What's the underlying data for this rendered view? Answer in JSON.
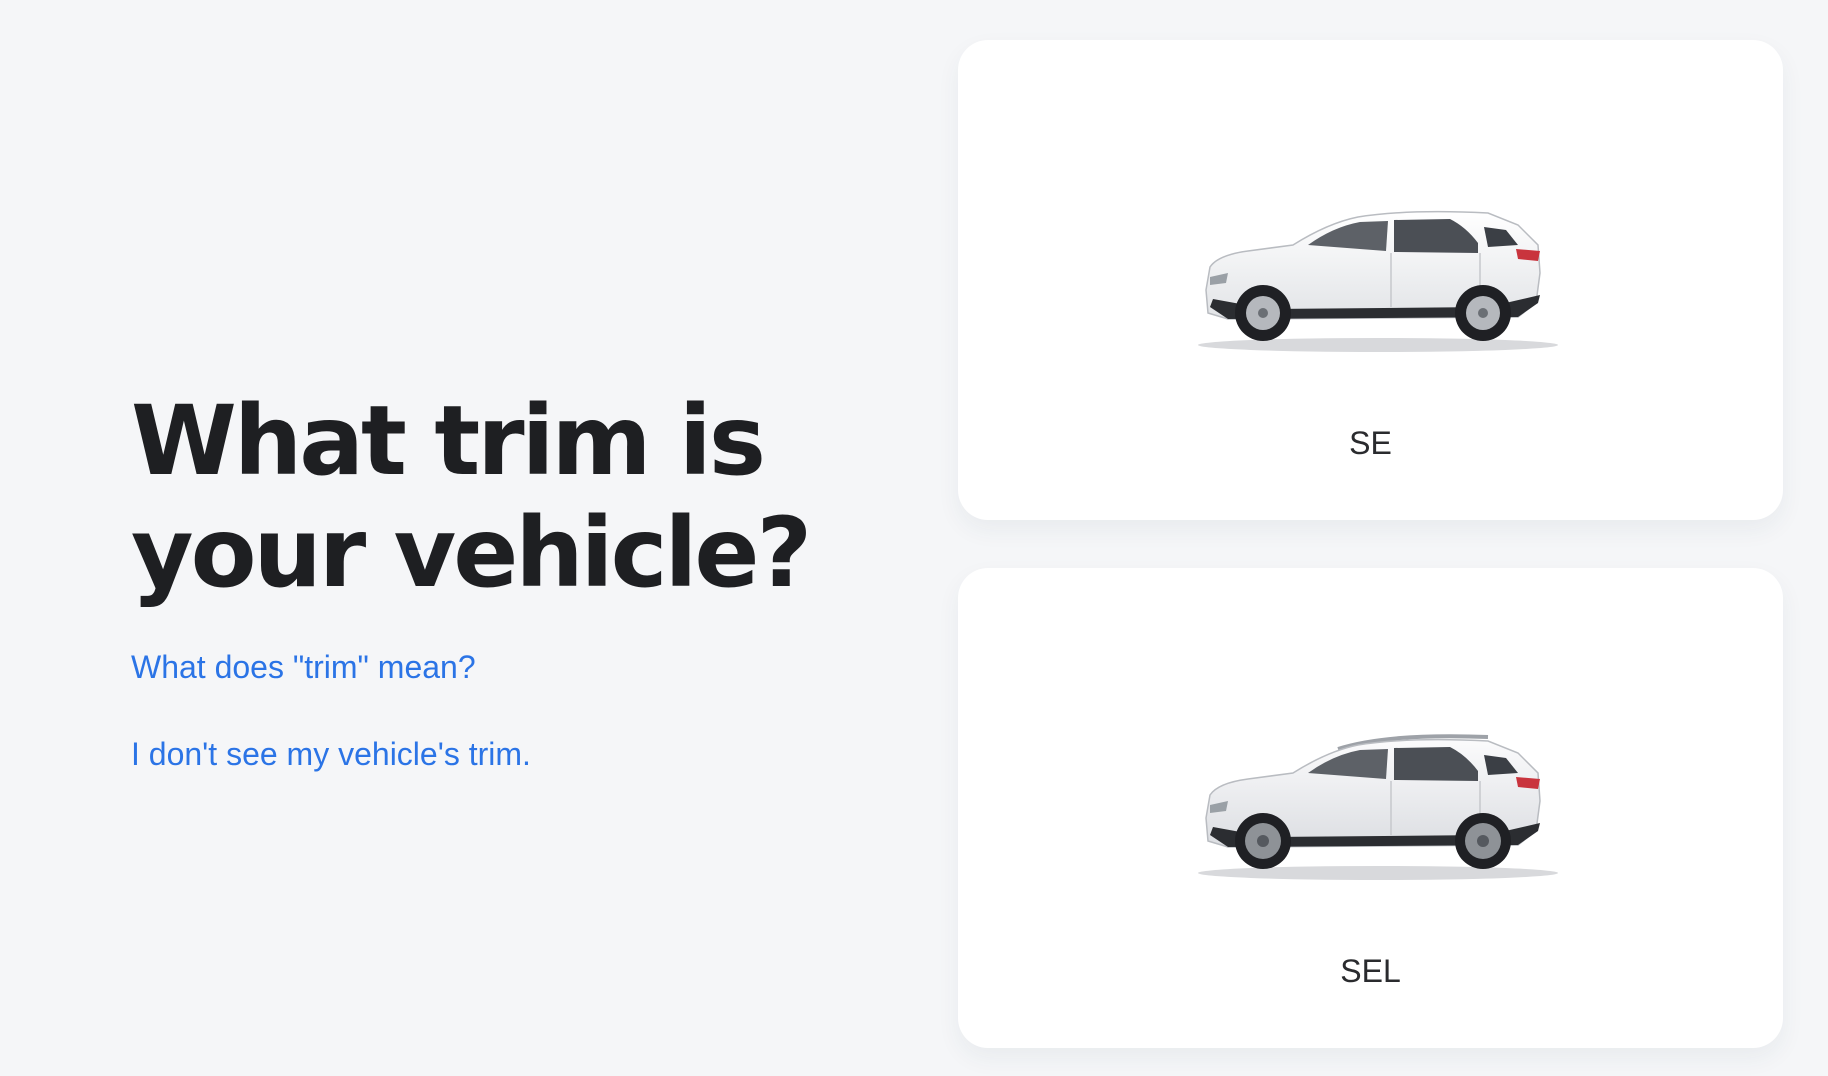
{
  "question": {
    "title": "What trim is your vehicle?",
    "links": [
      {
        "label": "What does \"trim\" mean?"
      },
      {
        "label": "I don't see my vehicle's trim."
      }
    ]
  },
  "trims": [
    {
      "label": "SE",
      "image": "white-suv-side-view"
    },
    {
      "label": "SEL",
      "image": "white-suv-side-view-roof-rails"
    }
  ],
  "colors": {
    "link": "#2b74e6",
    "title": "#1e1f22",
    "background": "#f5f6f8",
    "card": "#ffffff"
  }
}
